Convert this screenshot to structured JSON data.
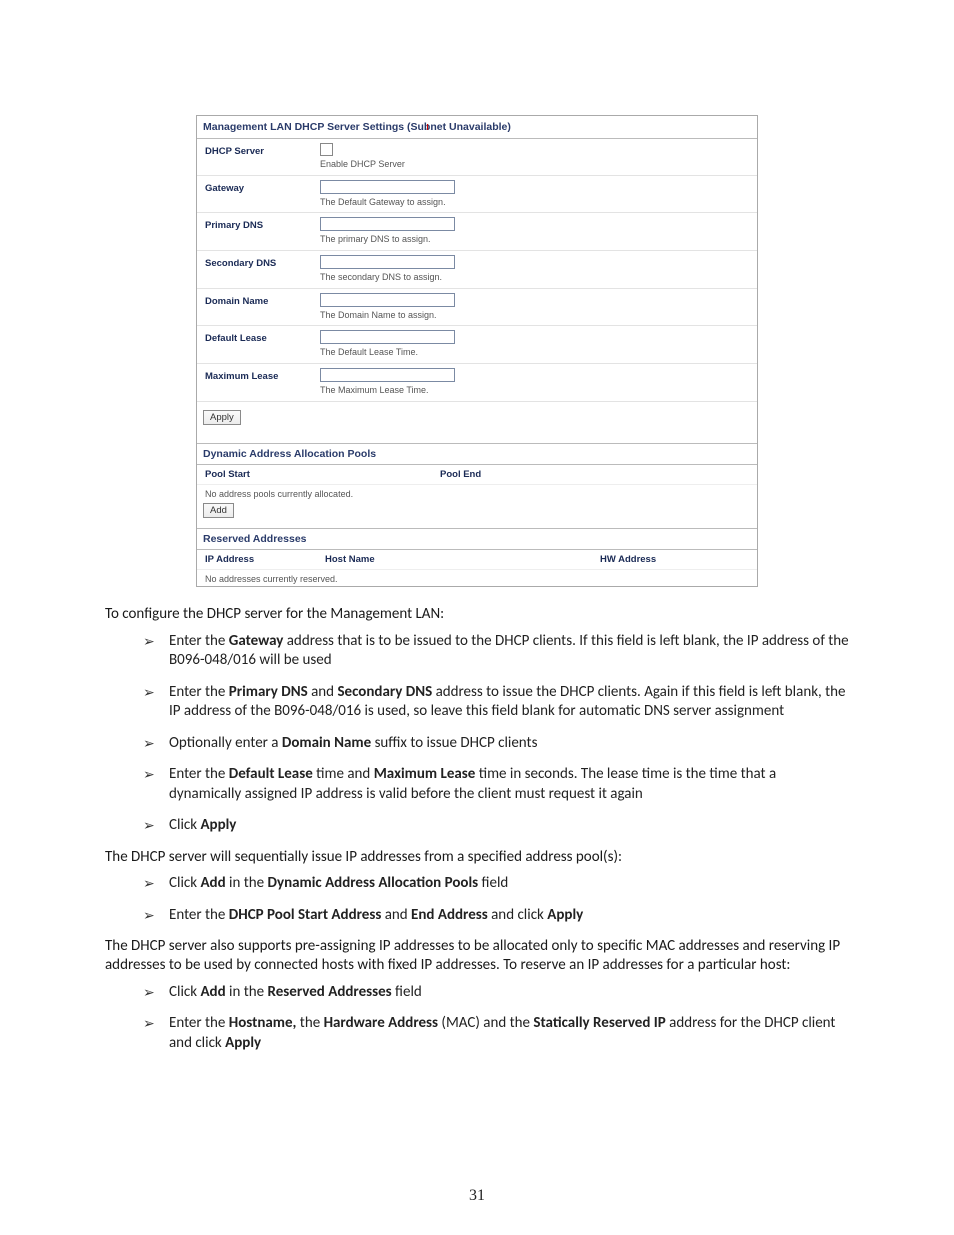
{
  "page_number": "31",
  "screenshot": {
    "title": "Management LAN DHCP Server Settings (Subnet Unavailable)",
    "rows": {
      "dhcp_server": {
        "label": "DHCP Server",
        "desc": "Enable DHCP Server"
      },
      "gateway": {
        "label": "Gateway",
        "desc": "The Default Gateway to assign."
      },
      "primary_dns": {
        "label": "Primary DNS",
        "desc": "The primary DNS to assign."
      },
      "secondary_dns": {
        "label": "Secondary DNS",
        "desc": "The secondary DNS to assign."
      },
      "domain_name": {
        "label": "Domain Name",
        "desc": "The Domain Name to assign."
      },
      "default_lease": {
        "label": "Default Lease",
        "desc": "The Default Lease Time."
      },
      "maximum_lease": {
        "label": "Maximum Lease",
        "desc": "The Maximum Lease Time."
      }
    },
    "apply_label": "Apply",
    "pools_title": "Dynamic Address Allocation Pools",
    "pools_cols": {
      "start": "Pool Start",
      "end": "Pool End"
    },
    "pools_empty": "No address pools currently allocated.",
    "add_label": "Add",
    "reserved_title": "Reserved Addresses",
    "reserved_cols": {
      "ip": "IP Address",
      "host": "Host Name",
      "hw": "HW Address"
    },
    "reserved_empty": "No addresses currently reserved."
  },
  "body": {
    "p1": "To configure the DHCP server for the Management LAN:",
    "list1": {
      "i1a": "Enter the ",
      "i1b": "Gateway",
      "i1c": " address that is to be issued to the DHCP clients. If this field is left blank, the IP address of the B096-048/016 will be used",
      "i2a": "Enter the ",
      "i2b": "Primary DNS",
      "i2c": " and ",
      "i2d": "Secondary DNS",
      "i2e": " address to issue the DHCP clients. Again if this field is left blank, the IP address of the B096-048/016 is used, so leave this field blank for automatic DNS server assignment",
      "i3a": "Optionally enter a ",
      "i3b": "Domain Name",
      "i3c": " suffix to issue DHCP clients",
      "i4a": "Enter the ",
      "i4b": "Default Lease",
      "i4c": " time and ",
      "i4d": "Maximum Lease",
      "i4e": " time in seconds. The lease time is the time that a dynamically assigned IP address is valid before the client must request it again",
      "i5a": "Click ",
      "i5b": "Apply"
    },
    "p2": "The DHCP server will sequentially issue IP addresses from a specified address pool(s):",
    "list2": {
      "i1a": "Click ",
      "i1b": "Add",
      "i1c": " in the ",
      "i1d": "Dynamic Address Allocation Pools",
      "i1e": " field",
      "i2a": "Enter the ",
      "i2b": "DHCP Pool Start Address",
      "i2c": " and ",
      "i2d": "End Address",
      "i2e": " and click ",
      "i2f": "Apply"
    },
    "p3": "The DHCP server also supports pre-assigning IP addresses to be allocated only to specific MAC addresses and reserving IP addresses to be used by connected hosts with fixed IP addresses. To reserve an IP addresses for a particular host:",
    "list3": {
      "i1a": "Click ",
      "i1b": "Add",
      "i1c": " in the ",
      "i1d": "Reserved Addresses",
      "i1e": " field",
      "i2a": "Enter the ",
      "i2b": "Hostname,",
      "i2c": " the ",
      "i2d": "Hardware Address",
      "i2e": " (MAC) and the ",
      "i2f": "Statically Reserved IP",
      "i2g": " address for the DHCP client and click ",
      "i2h": "Apply"
    }
  }
}
